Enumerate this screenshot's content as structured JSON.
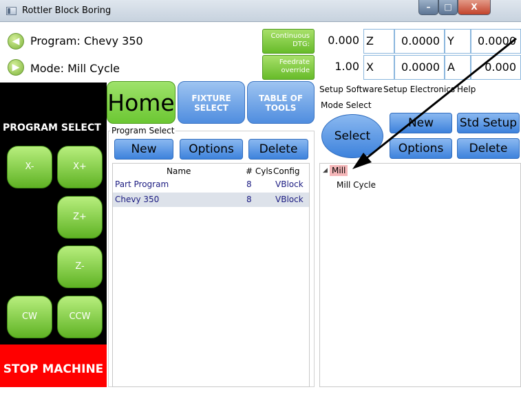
{
  "window": {
    "title": "Rottler Block Boring",
    "min": "–",
    "max": "□",
    "close": "X"
  },
  "header": {
    "program_label": "Program: Chevy 350",
    "mode_label": "Mode: Mill Cycle",
    "continuous_dtg": "Continuous DTG:",
    "feedrate_override": "Feedrate override"
  },
  "coordinates": {
    "feedrate_value": "0.000",
    "override_value": "1.00",
    "rows": [
      {
        "val1_label": "Z",
        "val2": "0.0000",
        "val2_label": "Y",
        "val3": "0.0000"
      },
      {
        "val1_label": "X",
        "val2": "0.0000",
        "val2_label": "A",
        "val3": "0.000"
      }
    ]
  },
  "jog": {
    "section_title": "PROGRAM SELECT",
    "x_minus": "X-",
    "x_plus": "X+",
    "z_plus": "Z+",
    "z_minus": "Z-",
    "cw": "CW",
    "ccw": "CCW",
    "stop": "STOP MACHINE"
  },
  "nav": {
    "home": "Home",
    "fixture_select": "FIXTURE SELECT",
    "table_of_tools": "TABLE OF TOOLS"
  },
  "program_select": {
    "group_label": "Program Select",
    "new": "New",
    "options": "Options",
    "delete": "Delete",
    "columns": [
      "Name",
      "# Cyls",
      "Config"
    ],
    "rows": [
      {
        "name": "Part Program",
        "cyls": "8",
        "config": "VBlock"
      },
      {
        "name": "Chevy 350",
        "cyls": "8",
        "config": "VBlock"
      }
    ]
  },
  "menu": {
    "items": [
      "Setup Software",
      "Setup Electronics",
      "Help"
    ]
  },
  "mode_select": {
    "group_label": "Mode Select",
    "select": "Select",
    "new": "New",
    "std_setup": "Std Setup",
    "options": "Options",
    "delete": "Delete",
    "tree": {
      "root": "Mill",
      "children": [
        "Mill Cycle"
      ]
    }
  },
  "colors": {
    "accent_green": "#67bb2a",
    "accent_blue": "#3d82dc",
    "stop_red": "#ff0000"
  }
}
